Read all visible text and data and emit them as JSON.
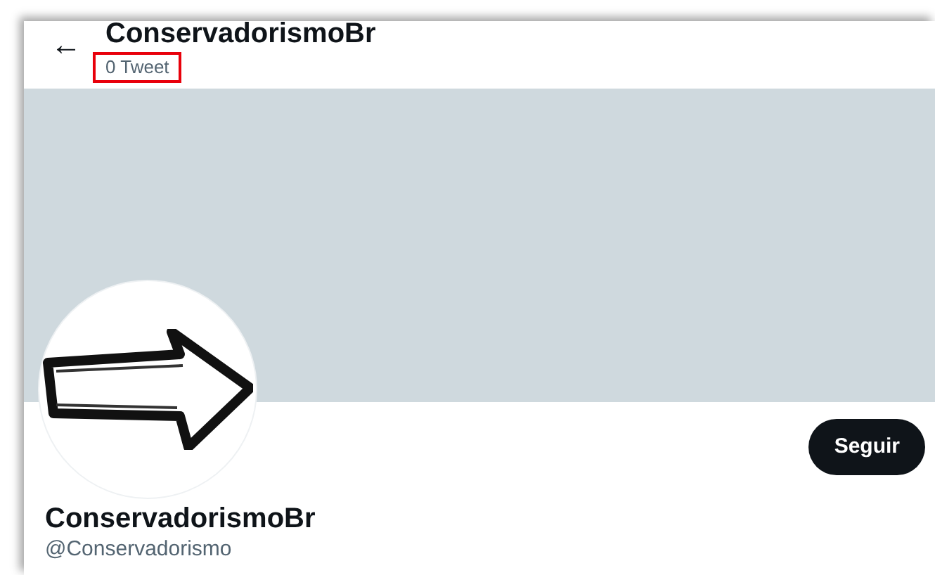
{
  "header": {
    "back": "←",
    "title": "ConservadorismoBr",
    "tweet_count": "0 Tweet"
  },
  "profile": {
    "follow_button": "Seguir",
    "name": "ConservadorismoBr",
    "handle": "@Conservadorismo"
  }
}
